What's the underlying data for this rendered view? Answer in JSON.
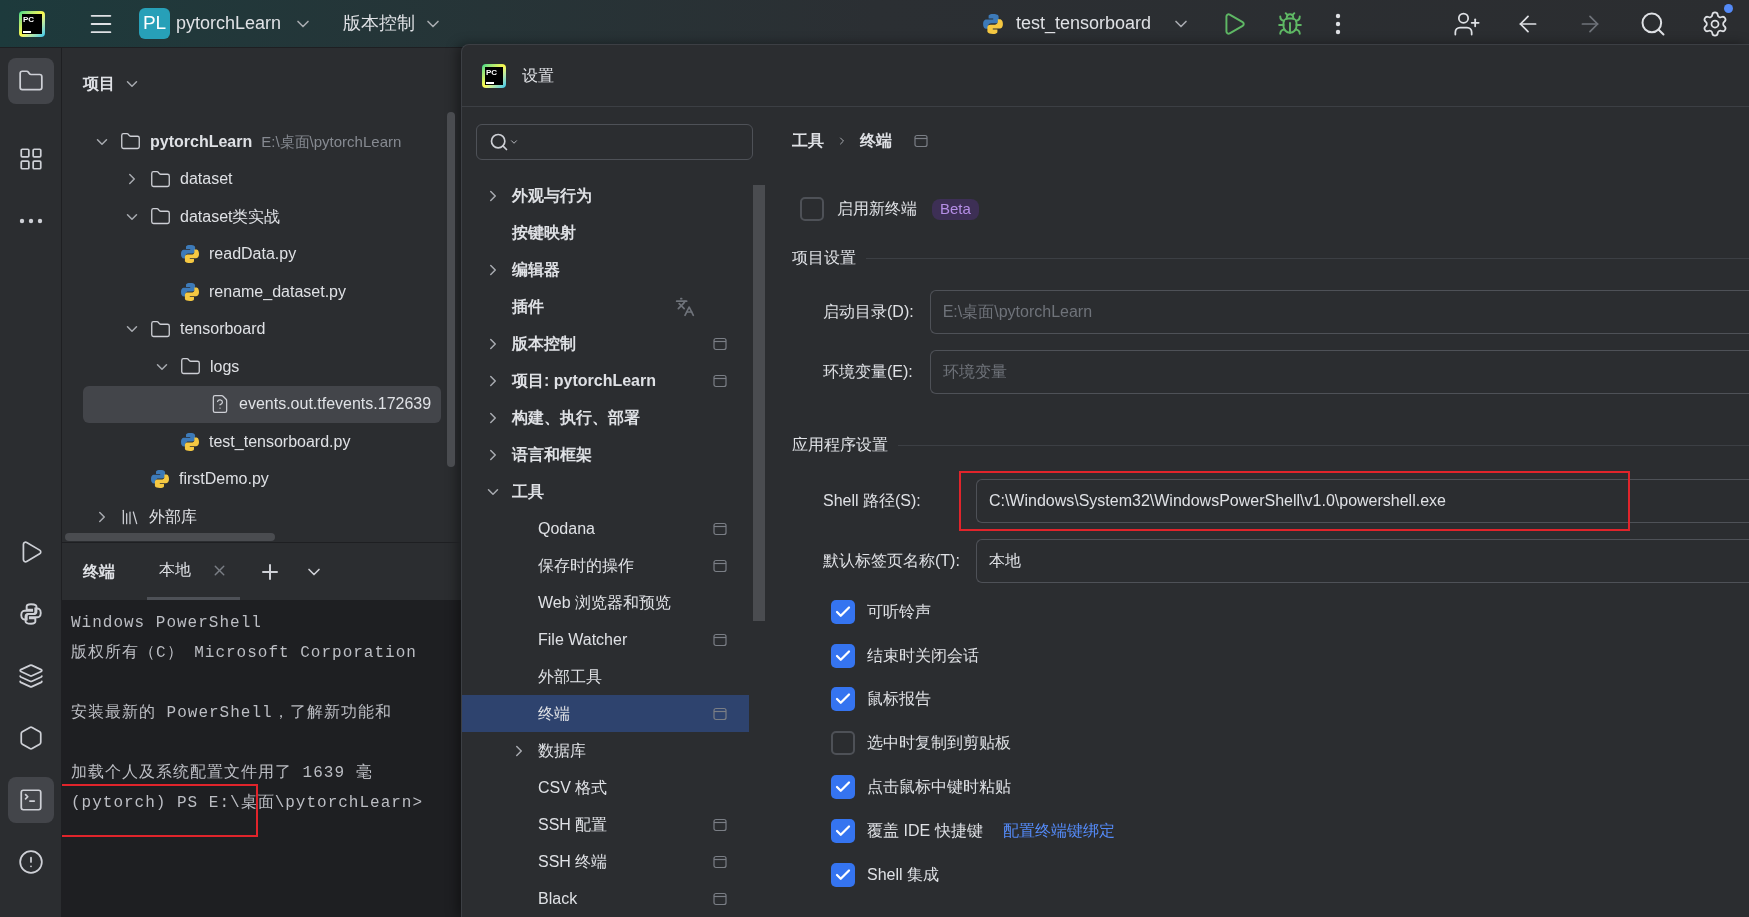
{
  "toolbar": {
    "logo_text": "PC",
    "project_badge": "PL",
    "project_name": "pytorchLearn",
    "vcs": "版本控制",
    "run_config": "test_tensorboard",
    "forward_disabled": true,
    "has_notification": true
  },
  "left_toolbar": [
    {
      "kind": "folder",
      "selected": true
    },
    {
      "kind": "structure",
      "selected": false
    },
    {
      "kind": "more",
      "selected": false
    },
    {
      "kind": "run",
      "selected": false
    },
    {
      "kind": "python",
      "selected": false
    },
    {
      "kind": "layers",
      "selected": false
    },
    {
      "kind": "services",
      "selected": false
    },
    {
      "kind": "terminal",
      "selected": true
    },
    {
      "kind": "problems",
      "selected": false
    }
  ],
  "project_panel": {
    "title": "项目",
    "tree": [
      {
        "name": "pytorchLearn",
        "kind": "folder",
        "expanded": true,
        "hint": "E:\\桌面\\pytorchLearn",
        "selected": false,
        "children": [
          {
            "name": "dataset",
            "kind": "folder",
            "expanded": false,
            "selected": false
          },
          {
            "name": "dataset类实战",
            "kind": "folder",
            "expanded": true,
            "selected": false,
            "children": [
              {
                "name": "readData.py",
                "kind": "python",
                "selected": false
              },
              {
                "name": "rename_dataset.py",
                "kind": "python",
                "selected": false
              }
            ]
          },
          {
            "name": "tensorboard",
            "kind": "folder",
            "expanded": true,
            "selected": false,
            "children": [
              {
                "name": "logs",
                "kind": "folder",
                "expanded": true,
                "selected": false,
                "children": [
                  {
                    "name": "events.out.tfevents.172639",
                    "kind": "unknown",
                    "selected": true
                  }
                ]
              },
              {
                "name": "test_tensorboard.py",
                "kind": "python",
                "selected": false
              }
            ]
          },
          {
            "name": "firstDemo.py",
            "kind": "python",
            "selected": false
          }
        ]
      },
      {
        "name": "外部库",
        "kind": "library",
        "expanded": false,
        "selected": false
      }
    ]
  },
  "terminal": {
    "title": "终端",
    "tabs": [
      {
        "label": "本地",
        "selected": true
      }
    ],
    "blocks": [
      {
        "lines": [
          {
            "text": "Windows PowerShell",
            "annotated": false
          },
          {
            "text": "版权所有（C） Microsoft Corporation",
            "annotated": false
          }
        ]
      },
      {
        "lines": [
          {
            "text": "安装最新的 PowerShell，了解新功能和",
            "annotated": false
          }
        ]
      },
      {
        "lines": [
          {
            "text": "加载个人及系统配置文件用了 1639 毫",
            "annotated": false
          },
          {
            "text": "(pytorch) PS E:\\桌面\\pytorchLearn>",
            "annotated": true
          }
        ]
      }
    ]
  },
  "settings": {
    "title": "设置",
    "logo_text": "PC",
    "nav": [
      {
        "label": "外观与行为",
        "bold": true,
        "expanded": false,
        "kind": "plain",
        "selected": false
      },
      {
        "label": "按键映射",
        "bold": true,
        "kind": "plain",
        "selected": false
      },
      {
        "label": "编辑器",
        "bold": true,
        "expanded": false,
        "kind": "plain",
        "selected": false
      },
      {
        "label": "插件",
        "bold": true,
        "kind": "translate",
        "selected": false
      },
      {
        "label": "版本控制",
        "bold": true,
        "expanded": false,
        "kind": "project",
        "selected": false
      },
      {
        "label": "项目: pytorchLearn",
        "bold": true,
        "expanded": false,
        "kind": "project",
        "selected": false
      },
      {
        "label": "构建、执行、部署",
        "bold": true,
        "expanded": false,
        "kind": "plain",
        "selected": false
      },
      {
        "label": "语言和框架",
        "bold": true,
        "expanded": false,
        "kind": "plain",
        "selected": false
      },
      {
        "label": "工具",
        "bold": true,
        "expanded": true,
        "kind": "plain",
        "selected": false,
        "children": [
          {
            "label": "Qodana",
            "bold": false,
            "kind": "project",
            "selected": false
          },
          {
            "label": "保存时的操作",
            "bold": false,
            "kind": "project",
            "selected": false
          },
          {
            "label": "Web 浏览器和预览",
            "bold": false,
            "kind": "plain",
            "selected": false
          },
          {
            "label": "File Watcher",
            "bold": false,
            "kind": "project",
            "selected": false
          },
          {
            "label": "外部工具",
            "bold": false,
            "kind": "plain",
            "selected": false
          },
          {
            "label": "终端",
            "bold": false,
            "kind": "project",
            "selected": true
          },
          {
            "label": "数据库",
            "bold": false,
            "expanded": false,
            "kind": "plain",
            "selected": false
          },
          {
            "label": "CSV 格式",
            "bold": false,
            "kind": "plain",
            "selected": false
          },
          {
            "label": "SSH 配置",
            "bold": false,
            "kind": "project",
            "selected": false
          },
          {
            "label": "SSH 终端",
            "bold": false,
            "kind": "project",
            "selected": false
          },
          {
            "label": "Black",
            "bold": false,
            "kind": "project",
            "selected": false
          }
        ]
      }
    ],
    "breadcrumb": [
      "工具",
      "终端"
    ],
    "new_terminal": {
      "label": "启用新终端",
      "checked": false,
      "badge": "Beta"
    },
    "sections": [
      {
        "title": "项目设置",
        "fields": [
          {
            "label": "启动目录(D):",
            "placeholder": "E:\\桌面\\pytorchLearn",
            "annotated": false
          },
          {
            "label": "环境变量(E):",
            "placeholder": "环境变量",
            "annotated": false
          }
        ]
      },
      {
        "title": "应用程序设置",
        "fields": [
          {
            "label": "Shell 路径(S):",
            "value": "C:\\Windows\\System32\\WindowsPowerShell\\v1.0\\powershell.exe",
            "annotated": true
          },
          {
            "label": "默认标签页名称(T):",
            "value": "本地",
            "annotated": false
          }
        ]
      }
    ],
    "options": [
      {
        "label": "可听铃声",
        "checked": true
      },
      {
        "label": "结束时关闭会话",
        "checked": true
      },
      {
        "label": "鼠标报告",
        "checked": true
      },
      {
        "label": "选中时复制到剪贴板",
        "checked": false
      },
      {
        "label": "点击鼠标中键时粘贴",
        "checked": true
      },
      {
        "label": "覆盖 IDE 快捷键",
        "checked": true,
        "link": "配置终端键绑定"
      },
      {
        "label": "Shell 集成",
        "checked": true
      }
    ]
  }
}
